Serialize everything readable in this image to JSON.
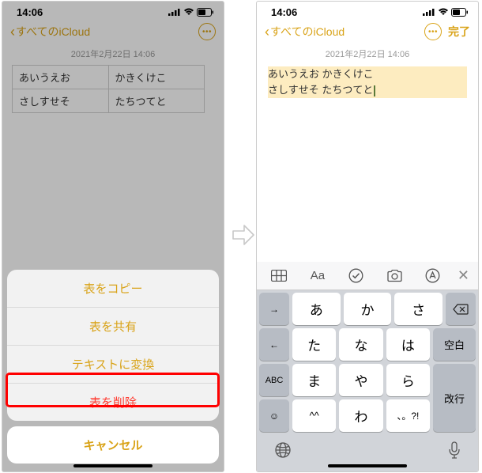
{
  "status": {
    "time": "14:06"
  },
  "nav": {
    "back_label": "すべてのiCloud",
    "done_label": "完了"
  },
  "note": {
    "timestamp": "2021年2月22日 14:06",
    "table": {
      "r1c1": "あいうえお",
      "r1c2": "かきくけこ",
      "r2c1": "さしすせそ",
      "r2c2": "たちつてと"
    },
    "line1": "あいうえお かきくけこ",
    "line2": "さしすせそ たちつてと"
  },
  "sheet": {
    "copy": "表をコピー",
    "share": "表を共有",
    "convert": "テキストに変換",
    "delete": "表を削除",
    "cancel": "キャンセル"
  },
  "kb": {
    "tool_aa": "Aa",
    "rows": [
      [
        "→",
        "あ",
        "か",
        "さ",
        "⌫"
      ],
      [
        "←",
        "た",
        "な",
        "は",
        "空白"
      ],
      [
        "ABC",
        "ま",
        "や",
        "ら",
        "改行"
      ],
      [
        "☺",
        "^^",
        "わ",
        "、。?!",
        ""
      ]
    ]
  }
}
